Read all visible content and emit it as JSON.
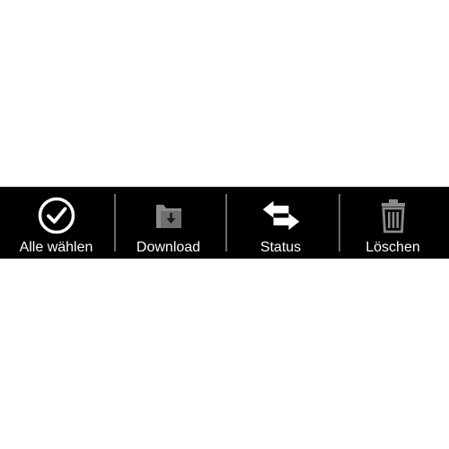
{
  "toolbar": {
    "background": "#000000",
    "items": [
      {
        "label": "Alle wählen",
        "icon": "check-circle-icon",
        "enabled": true,
        "icon_color": "#ffffff"
      },
      {
        "label": "Download",
        "icon": "folder-download-icon",
        "enabled": false,
        "icon_color": "#8a8a8a"
      },
      {
        "label": "Status",
        "icon": "swap-arrows-icon",
        "enabled": true,
        "icon_color": "#ffffff"
      },
      {
        "label": "Löschen",
        "icon": "trash-icon",
        "enabled": false,
        "icon_color": "#8a8a8a"
      }
    ]
  }
}
